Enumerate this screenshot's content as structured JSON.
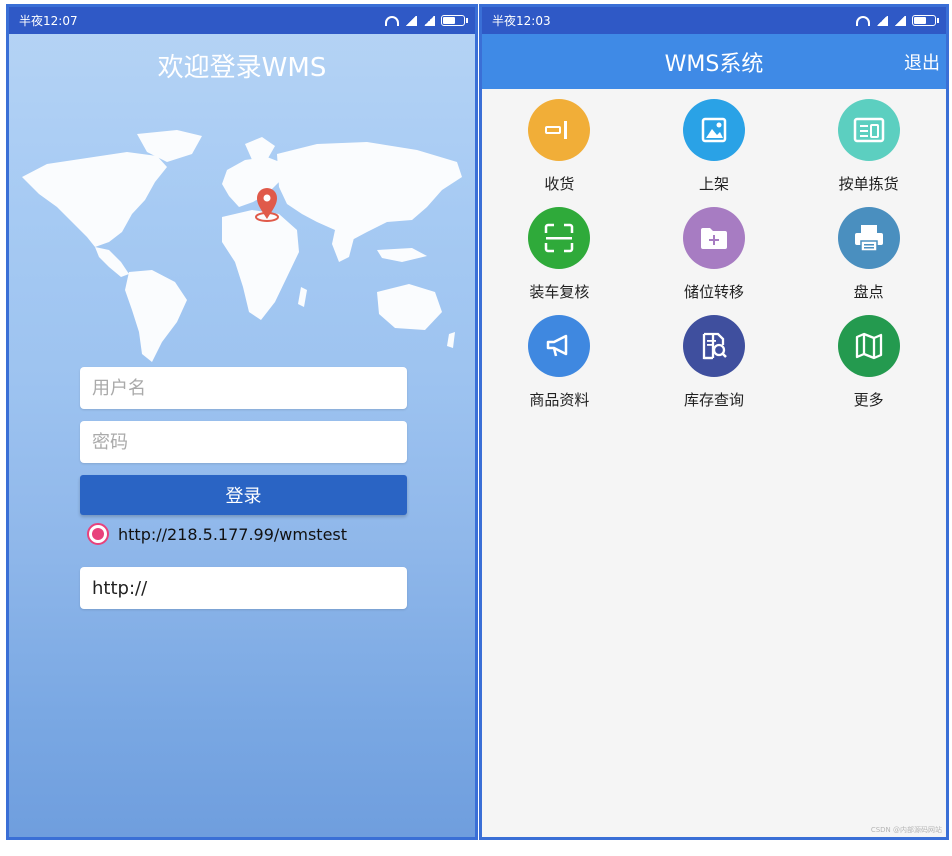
{
  "login_screen": {
    "status_time": "半夜12:07",
    "title": "欢迎登录WMS",
    "username_placeholder": "用户名",
    "password_placeholder": "密码",
    "login_label": "登录",
    "server_option": "http://218.5.177.99/wmstest",
    "url_input_value": "http://"
  },
  "home_screen": {
    "status_time": "半夜12:03",
    "title": "WMS系统",
    "logout_label": "退出",
    "tiles": [
      {
        "label": "收货",
        "icon": "receive-icon",
        "color": "#f1ae38"
      },
      {
        "label": "上架",
        "icon": "image-icon",
        "color": "#2aa2e6"
      },
      {
        "label": "按单拣货",
        "icon": "list-card-icon",
        "color": "#5ccfc0"
      },
      {
        "label": "装车复核",
        "icon": "scan-icon",
        "color": "#2faa3a"
      },
      {
        "label": "储位转移",
        "icon": "folder-plus-icon",
        "color": "#a77cc2"
      },
      {
        "label": "盘点",
        "icon": "printer-icon",
        "color": "#4a8fbf"
      },
      {
        "label": "商品资料",
        "icon": "megaphone-icon",
        "color": "#3f88e0"
      },
      {
        "label": "库存查询",
        "icon": "document-search-icon",
        "color": "#3f4f9e"
      },
      {
        "label": "更多",
        "icon": "map-icon",
        "color": "#249a4f"
      }
    ],
    "watermark": "CSDN @内部源码网站"
  }
}
